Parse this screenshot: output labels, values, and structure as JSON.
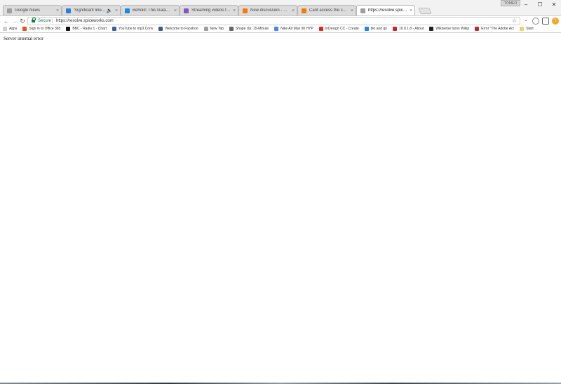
{
  "browser": {
    "tabs": [
      {
        "label": "Google News",
        "favicon_color": "#9e9e9e",
        "active": false
      },
      {
        "label": "'Significant line of inq",
        "favicon_color": "#2a7fd4",
        "active": false,
        "audio": true
      },
      {
        "label": "Behold: This Galaxy Nota",
        "favicon_color": "#1e88e5",
        "active": false
      },
      {
        "label": "Streaming videos from y",
        "favicon_color": "#7e57c2",
        "active": false
      },
      {
        "label": "New discussion - Spicew",
        "favicon_color": "#f57c00",
        "active": false
      },
      {
        "label": "Cant access the connect",
        "favicon_color": "#f57c00",
        "active": false
      },
      {
        "label": "https://resolve.spiceworks",
        "favicon_color": "#9e9e9e",
        "active": true
      }
    ],
    "close_glyph": "×",
    "profile_label": "TOMEO",
    "window_controls": {
      "minimize": "–",
      "maximize": "☐",
      "close": "✕"
    }
  },
  "toolbar": {
    "back_icon": "←",
    "forward_icon": "→",
    "reload_icon": "↻",
    "secure_label": "Secure",
    "url": "https://resolve.spiceworks.com",
    "star_icon": "☆"
  },
  "bookmarks": [
    {
      "label": "Apps",
      "type": "apps"
    },
    {
      "label": "Sign in to Office 365",
      "color": "#e8501f"
    },
    {
      "label": "BBC - Radio 1 - Chart",
      "color": "#111111"
    },
    {
      "label": "YouTube to mp3 Conv",
      "color": "#3a5fa8"
    },
    {
      "label": "Welcome to Faceboo",
      "color": "#3b5998"
    },
    {
      "label": "New Tab",
      "color": "#9e9e9e"
    },
    {
      "label": "Shape Up: 15-Minute",
      "color": "#666666"
    },
    {
      "label": "Nike Air Max 90 HYP",
      "color": "#4285f4"
    },
    {
      "label": "InDesign CC - Create",
      "color": "#e62117"
    },
    {
      "label": "blo and go",
      "color": "#1e88e5"
    },
    {
      "label": "10.0.1.8 - About",
      "color": "#c62828"
    },
    {
      "label": "Wikiverse turns Wikip",
      "color": "#222222"
    },
    {
      "label": "Error \"The Adobe Acr",
      "color": "#c62828"
    },
    {
      "label": "Start",
      "type": "folder"
    }
  ],
  "page": {
    "message": "Server internal error"
  }
}
